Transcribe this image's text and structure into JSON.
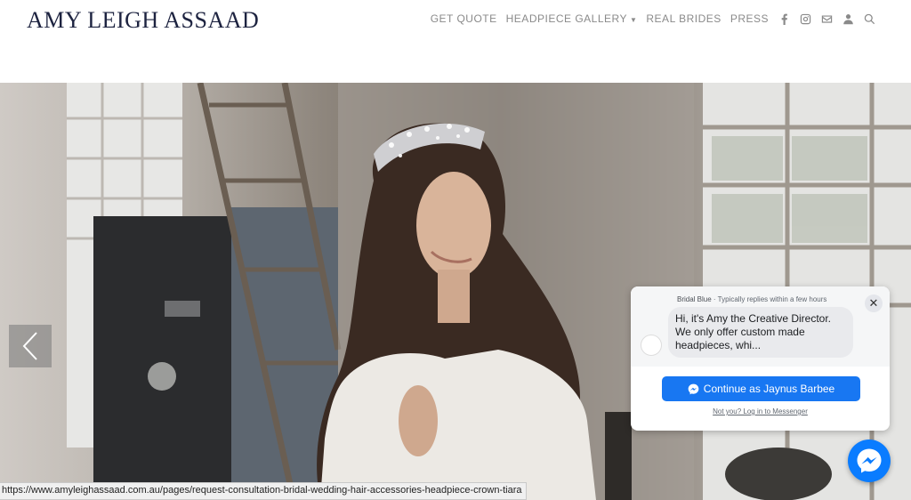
{
  "brand": {
    "logo_text": "AMY LEIGH ASSAAD"
  },
  "nav": {
    "items": [
      {
        "label": "GET QUOTE"
      },
      {
        "label": "HEADPIECE GALLERY",
        "has_dropdown": true
      },
      {
        "label": "REAL BRIDES"
      },
      {
        "label": "PRESS"
      }
    ],
    "icons": [
      "facebook-icon",
      "instagram-icon",
      "mail-icon",
      "user-icon",
      "search-icon"
    ]
  },
  "hero": {
    "image": "bride-with-crystal-crown-headpiece",
    "prev_arrow": "chevron-left-icon"
  },
  "status_bar": {
    "url": "https://www.amyleighassaad.com.au/pages/request-consultation-bridal-wedding-hair-accessories-headpiece-crown-tiara"
  },
  "chat_widget": {
    "page_name": "Bridal Blue",
    "reply_time": "Typically replies within a few hours",
    "message": "Hi, it's Amy the Creative Director. We only offer custom made headpieces, whi...",
    "continue_label": "Continue as Jaynus Barbee",
    "login_link": "Not you? Log in to Messenger",
    "close_icon": "close-icon"
  },
  "colors": {
    "logo": "#1d2340",
    "nav": "#8a8a8a",
    "messenger_blue": "#1877f2",
    "fab_blue": "#0a7cff"
  }
}
